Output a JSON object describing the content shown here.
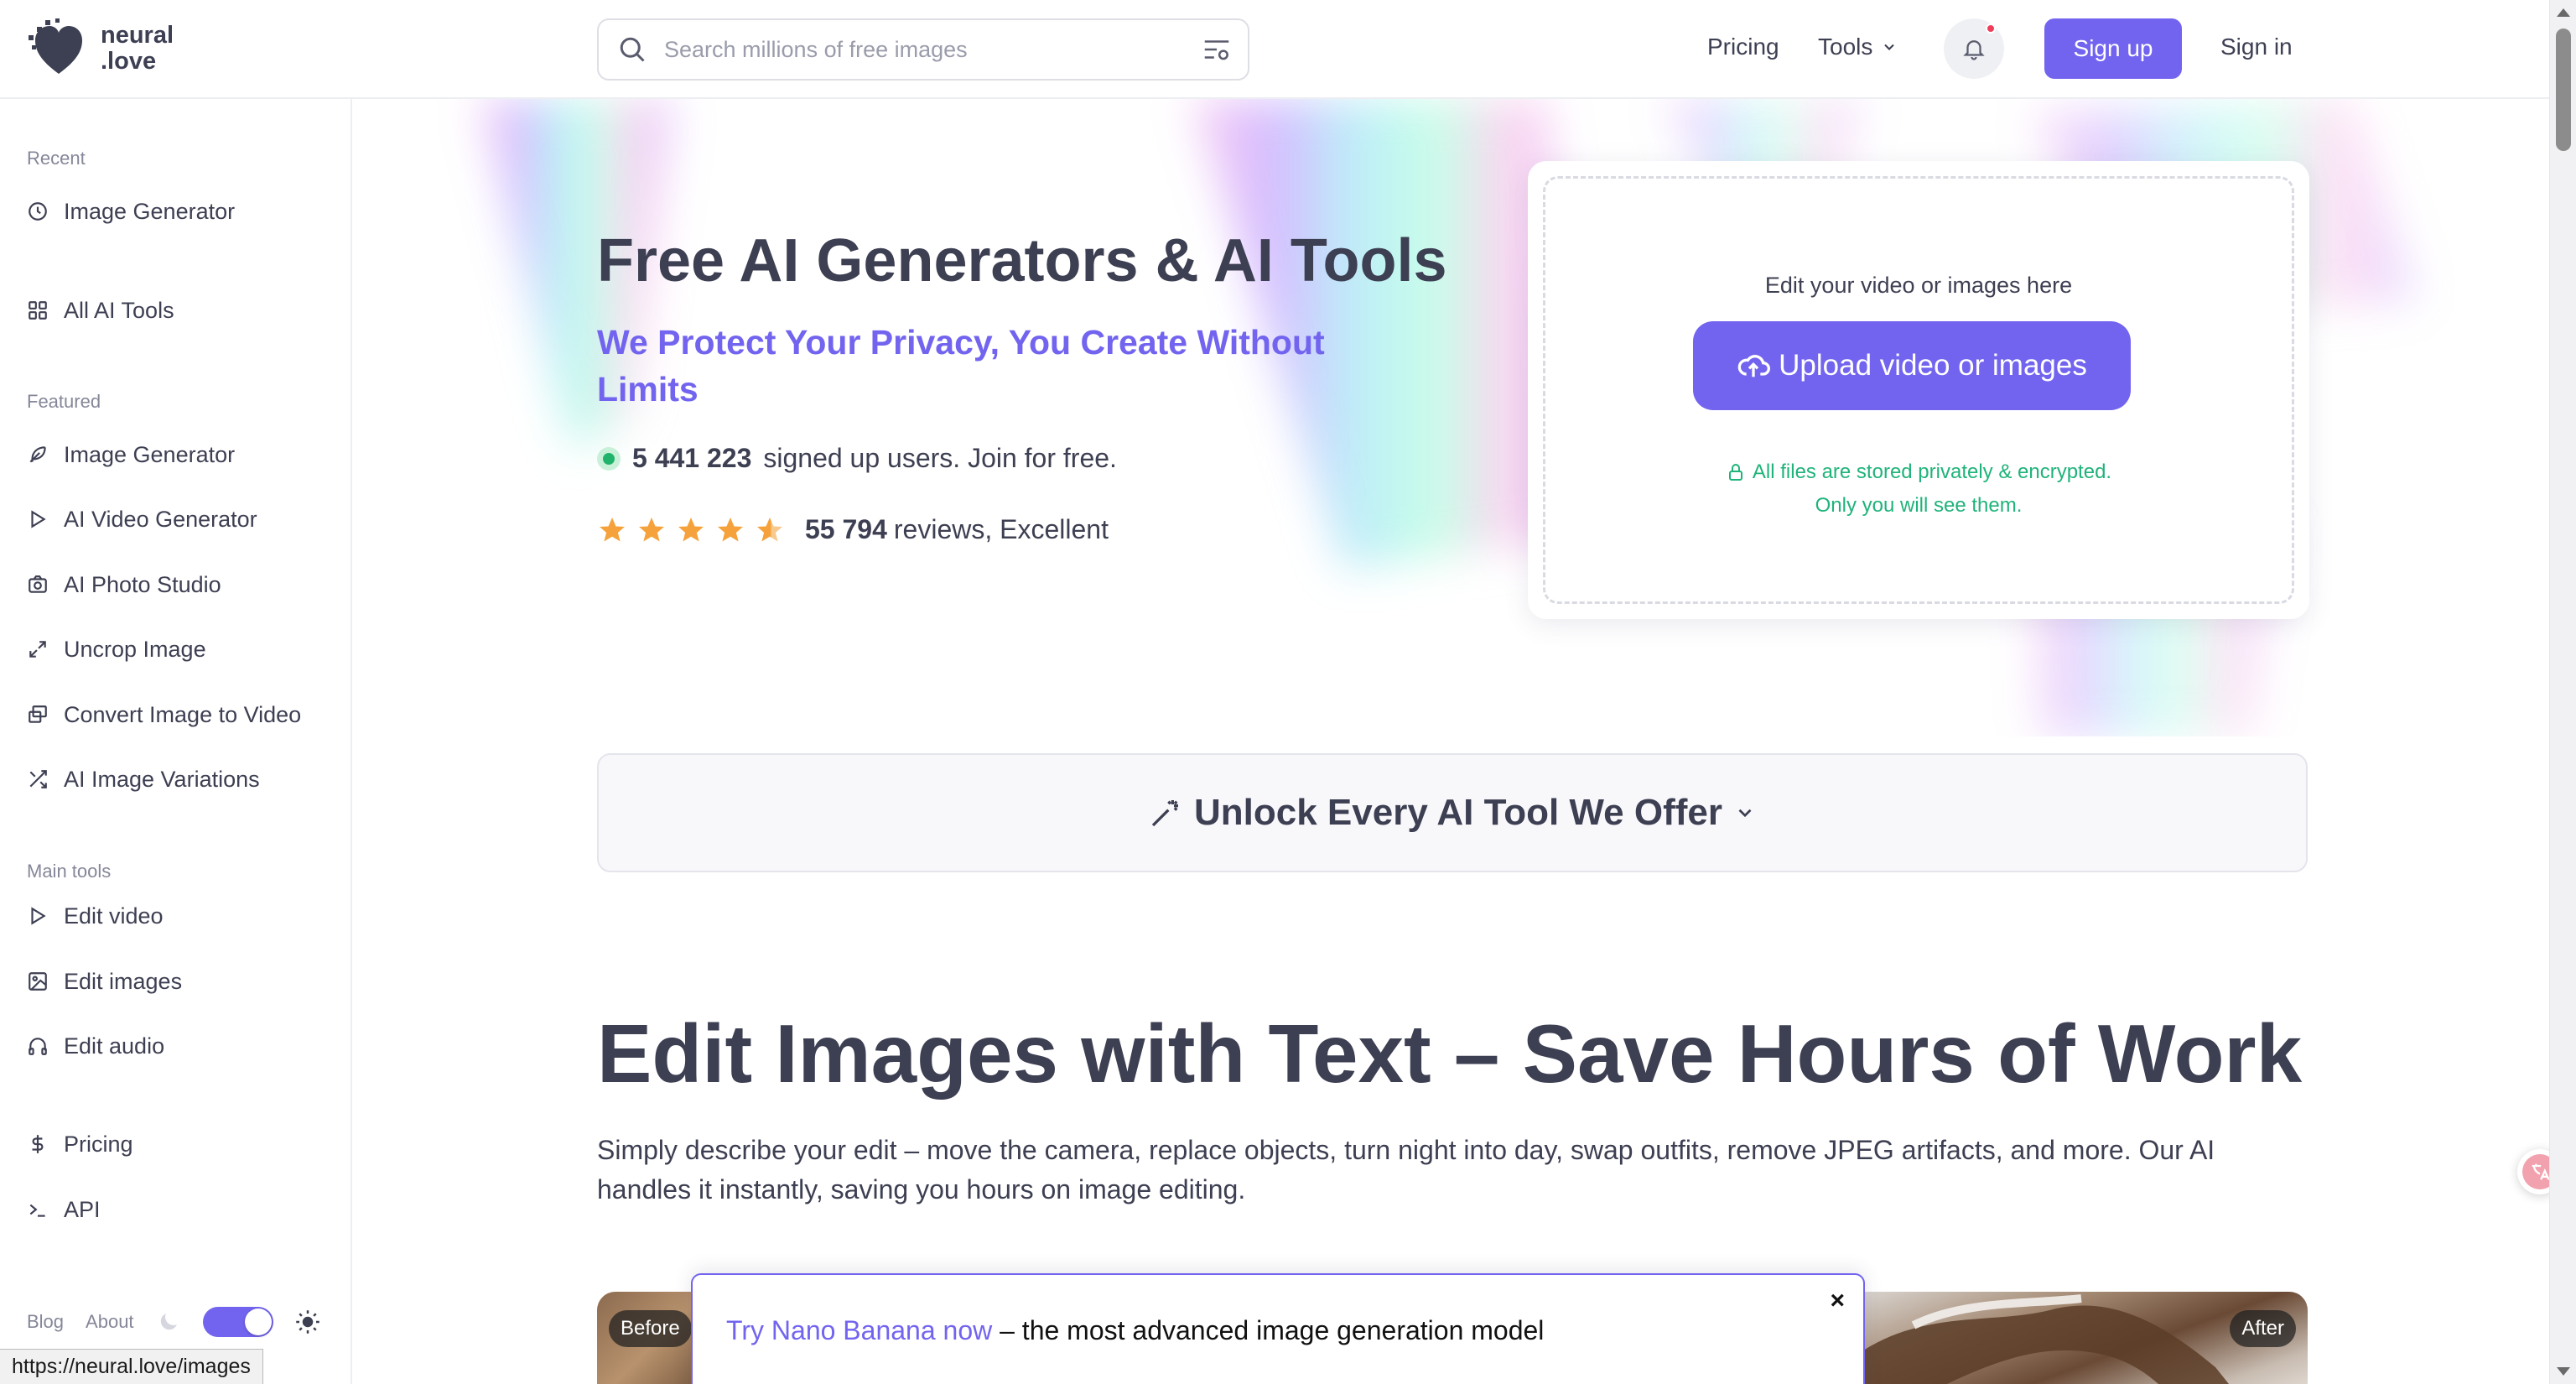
{
  "brand": {
    "logo_text": "neural\n.love"
  },
  "header": {
    "search_placeholder": "Search millions of free images",
    "pricing": "Pricing",
    "tools": "Tools",
    "sign_up": "Sign up",
    "sign_in": "Sign in"
  },
  "sidebar": {
    "recent_label": "Recent",
    "recent": [
      {
        "label": "Image Generator",
        "icon": "clock-icon"
      }
    ],
    "all_tools": {
      "label": "All AI Tools",
      "icon": "grid-icon"
    },
    "featured_label": "Featured",
    "featured": [
      {
        "label": "Image Generator",
        "icon": "feather-icon"
      },
      {
        "label": "AI Video Generator",
        "icon": "play-icon"
      },
      {
        "label": "AI Photo Studio",
        "icon": "camera-icon"
      },
      {
        "label": "Uncrop Image",
        "icon": "expand-icon"
      },
      {
        "label": "Convert Image to Video",
        "icon": "image-stack-icon"
      },
      {
        "label": "AI Image Variations",
        "icon": "shuffle-icon"
      }
    ],
    "main_tools_label": "Main tools",
    "main_tools": [
      {
        "label": "Edit video",
        "icon": "play-icon"
      },
      {
        "label": "Edit images",
        "icon": "image-icon"
      },
      {
        "label": "Edit audio",
        "icon": "headphones-icon"
      }
    ],
    "extras": [
      {
        "label": "Pricing",
        "icon": "dollar-icon"
      },
      {
        "label": "API",
        "icon": "terminal-icon"
      }
    ],
    "footer": {
      "blog": "Blog",
      "about": "About"
    }
  },
  "hero": {
    "title": "Free AI Generators & AI Tools",
    "subtitle": "We Protect Your Privacy, You Create Without Limits",
    "users_count": "5 441 223",
    "users_text": "signed up users. Join for free.",
    "rating_stars": 4.5,
    "reviews_count": "55 794",
    "reviews_text": "reviews, Excellent"
  },
  "upload": {
    "hint": "Edit your video or images here",
    "button": "Upload video or images",
    "privacy_line1": "All files are stored privately & encrypted.",
    "privacy_line2": "Only you will see them."
  },
  "unlock": {
    "label": "Unlock Every AI Tool We Offer"
  },
  "section": {
    "title": "Edit Images with Text – Save Hours of Work",
    "description": "Simply describe your edit – move the camera, replace objects, turn night into day, swap outfits, remove JPEG artifacts, and more. Our AI handles it instantly, saving you hours on image editing."
  },
  "comparison": {
    "before": "Before",
    "after": "After"
  },
  "promo": {
    "link": "Try Nano Banana now",
    "text": " – the most advanced image generation model",
    "close": "×"
  },
  "status_url": "https://neural.love/images",
  "colors": {
    "accent": "#7264ef",
    "text": "#3d3f52",
    "success": "#1fb37a",
    "star": "#f5a23c"
  }
}
